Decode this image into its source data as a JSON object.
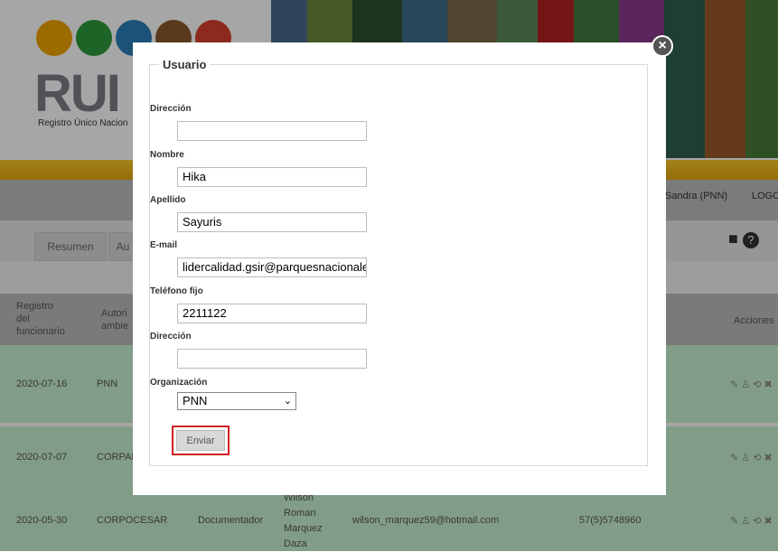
{
  "app": {
    "logo_text": "RUI",
    "logo_subtitle": "Registro Único Nacion",
    "user": "Sandra (PNN)",
    "logout": "LOGOU"
  },
  "tabs": [
    {
      "label": "Resumen"
    },
    {
      "label": "Au"
    }
  ],
  "table": {
    "headers": [
      {
        "label": "Registro\ndel\nfuncionario"
      },
      {
        "label": "Autori\nambie"
      },
      {
        "label": "Acciones"
      }
    ],
    "rows": [
      {
        "date": "2020-07-16",
        "org": "PNN",
        "role": "",
        "name": "",
        "email": "",
        "phone": ""
      },
      {
        "date": "2020-07-07",
        "org": "CORPAN",
        "role": "",
        "name": "",
        "email": "",
        "phone": ""
      },
      {
        "date": "2020-05-30",
        "org": "CORPOCESAR",
        "role": "Documentador",
        "name": "Wilson\nRoman\nMarquez\nDaza",
        "email": "wilson_marquez59@hotmail.com",
        "phone": "57(5)5748960"
      }
    ]
  },
  "modal": {
    "legend": "Usuario",
    "fields": {
      "direccion1": {
        "label": "Dirección",
        "value": ""
      },
      "nombre": {
        "label": "Nombre",
        "value": "Hika"
      },
      "apellido": {
        "label": "Apellido",
        "value": "Sayuris"
      },
      "email": {
        "label": "E-mail",
        "value": "lidercalidad.gsir@parquesnacionales"
      },
      "telefono": {
        "label": "Teléfono fijo",
        "value": "2211122"
      },
      "direccion2": {
        "label": "Dirección",
        "value": ""
      },
      "organizacion": {
        "label": "Organización",
        "value": "PNN"
      }
    },
    "submit_label": "Enviar",
    "close_icon": "close-icon"
  },
  "colors": {
    "highlight_border": "#d12027",
    "row_green": "#c6f2cf",
    "yellow_bar": "#f7c728"
  }
}
